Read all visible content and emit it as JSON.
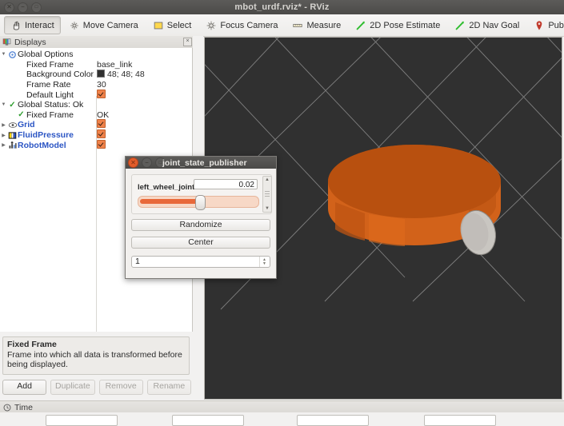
{
  "window": {
    "title": "mbot_urdf.rviz* - RViz",
    "controls": [
      "close",
      "minimize",
      "maximize"
    ]
  },
  "toolbar": {
    "items": [
      {
        "label": "Interact",
        "icon": "hand-icon",
        "active": true
      },
      {
        "label": "Move Camera",
        "icon": "move-camera-icon",
        "active": false
      },
      {
        "label": "Select",
        "icon": "select-icon",
        "active": false
      },
      {
        "label": "Focus Camera",
        "icon": "focus-camera-icon",
        "active": false
      },
      {
        "label": "Measure",
        "icon": "measure-icon",
        "active": false
      },
      {
        "label": "2D Pose Estimate",
        "icon": "pose-estimate-icon",
        "active": false
      },
      {
        "label": "2D Nav Goal",
        "icon": "nav-goal-icon",
        "active": false
      },
      {
        "label": "Publish Point",
        "icon": "publish-point-icon",
        "active": false
      },
      {
        "label": "",
        "icon": "add-tool-icon",
        "active": false
      },
      {
        "label": "",
        "icon": "remove-tool-icon",
        "active": false
      }
    ]
  },
  "displays": {
    "panel_title": "Displays",
    "close_label": "×",
    "rows": [
      {
        "indent": 0,
        "arrow": "▼",
        "icon": "global-options-icon",
        "label": "Global Options",
        "link": false,
        "value_type": "none",
        "value": ""
      },
      {
        "indent": 1,
        "arrow": "",
        "icon": "",
        "label": "Fixed Frame",
        "link": false,
        "value_type": "text",
        "value": "base_link"
      },
      {
        "indent": 1,
        "arrow": "",
        "icon": "",
        "label": "Background Color",
        "link": false,
        "value_type": "color",
        "value": "48; 48; 48"
      },
      {
        "indent": 1,
        "arrow": "",
        "icon": "",
        "label": "Frame Rate",
        "link": false,
        "value_type": "text",
        "value": "30"
      },
      {
        "indent": 1,
        "arrow": "",
        "icon": "",
        "label": "Default Light",
        "link": false,
        "value_type": "check",
        "value": ""
      },
      {
        "indent": 0,
        "arrow": "▼",
        "icon": "status-ok-icon",
        "label": "Global Status: Ok",
        "link": false,
        "value_type": "none",
        "value": ""
      },
      {
        "indent": 1,
        "arrow": "",
        "icon": "status-ok-icon",
        "label": "Fixed Frame",
        "link": false,
        "value_type": "text",
        "value": "OK"
      },
      {
        "indent": 0,
        "arrow": "▶",
        "icon": "grid-icon",
        "label": "Grid",
        "link": true,
        "value_type": "check",
        "value": ""
      },
      {
        "indent": 0,
        "arrow": "▶",
        "icon": "fluid-pressure-icon",
        "label": "FluidPressure",
        "link": true,
        "value_type": "check",
        "value": ""
      },
      {
        "indent": 0,
        "arrow": "▶",
        "icon": "robot-model-icon",
        "label": "RobotModel",
        "link": true,
        "value_type": "check",
        "value": ""
      }
    ],
    "help": {
      "title": "Fixed Frame",
      "text": "Frame into which all data is transformed before being displayed."
    },
    "buttons": [
      {
        "label": "Add",
        "enabled": true
      },
      {
        "label": "Duplicate",
        "enabled": false
      },
      {
        "label": "Remove",
        "enabled": false
      },
      {
        "label": "Rename",
        "enabled": false
      }
    ]
  },
  "viewport": {
    "background_color": "#303030",
    "grid_color": "#9a9a9a",
    "robot_body_color": "#d2621a",
    "robot_top_color": "#b8500f",
    "wheel_color": "#c9c6c1"
  },
  "dialog": {
    "title": "joint_state_publisher",
    "joint": {
      "name": "left_wheel_joint",
      "value": "0.02",
      "slider_percent": 52
    },
    "randomize_label": "Randomize",
    "center_label": "Center",
    "spin_value": "1"
  },
  "time_panel": {
    "title": "Time"
  }
}
